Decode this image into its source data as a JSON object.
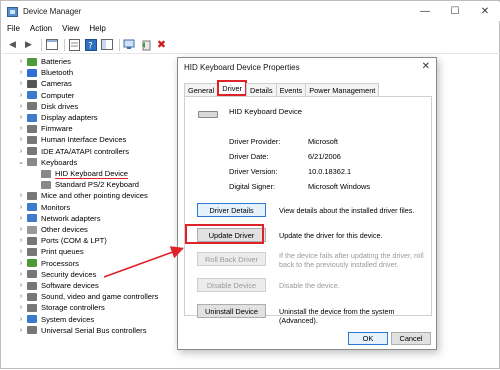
{
  "window": {
    "title": "Device Manager",
    "controls": {
      "minimize": "—",
      "maximize": "☐",
      "close": "✕"
    }
  },
  "menu": [
    "File",
    "Action",
    "View",
    "Help"
  ],
  "tree": [
    {
      "label": "Batteries",
      "expanded": false,
      "color": "#4e9a3a"
    },
    {
      "label": "Bluetooth",
      "expanded": false,
      "color": "#2d6fd6"
    },
    {
      "label": "Cameras",
      "expanded": false,
      "color": "#555555"
    },
    {
      "label": "Computer",
      "expanded": false,
      "color": "#3d7cc9"
    },
    {
      "label": "Disk drives",
      "expanded": false,
      "color": "#777777"
    },
    {
      "label": "Display adapters",
      "expanded": false,
      "color": "#3d7cc9"
    },
    {
      "label": "Firmware",
      "expanded": false,
      "color": "#777777"
    },
    {
      "label": "Human Interface Devices",
      "expanded": false,
      "color": "#777777"
    },
    {
      "label": "IDE ATA/ATAPI controllers",
      "expanded": false,
      "color": "#777777"
    },
    {
      "label": "Keyboards",
      "expanded": true,
      "color": "#888888"
    },
    {
      "label": "HID Keyboard Device",
      "child": true,
      "highlight": true,
      "color": "#888888"
    },
    {
      "label": "Standard PS/2 Keyboard",
      "child": true,
      "color": "#888888"
    },
    {
      "label": "Mice and other pointing devices",
      "expanded": false,
      "color": "#777777"
    },
    {
      "label": "Monitors",
      "expanded": false,
      "color": "#3d7cc9"
    },
    {
      "label": "Network adapters",
      "expanded": false,
      "color": "#3d7cc9"
    },
    {
      "label": "Other devices",
      "expanded": false,
      "color": "#999999"
    },
    {
      "label": "Ports (COM & LPT)",
      "expanded": false,
      "color": "#777777"
    },
    {
      "label": "Print queues",
      "expanded": false,
      "color": "#777777"
    },
    {
      "label": "Processors",
      "expanded": false,
      "color": "#4e9a3a"
    },
    {
      "label": "Security devices",
      "expanded": false,
      "color": "#777777"
    },
    {
      "label": "Software devices",
      "expanded": false,
      "color": "#777777"
    },
    {
      "label": "Sound, video and game controllers",
      "expanded": false,
      "color": "#777777"
    },
    {
      "label": "Storage controllers",
      "expanded": false,
      "color": "#777777"
    },
    {
      "label": "System devices",
      "expanded": false,
      "color": "#3d7cc9"
    },
    {
      "label": "Universal Serial Bus controllers",
      "expanded": false,
      "color": "#777777"
    }
  ],
  "dialog": {
    "title": "HID Keyboard Device Properties",
    "close": "✕",
    "tabs": [
      "General",
      "Driver",
      "Details",
      "Events",
      "Power Management"
    ],
    "active_tab": "Driver",
    "device_name": "HID Keyboard Device",
    "fields": [
      {
        "key": "Driver Provider:",
        "value": "Microsoft"
      },
      {
        "key": "Driver Date:",
        "value": "6/21/2006"
      },
      {
        "key": "Driver Version:",
        "value": "10.0.18362.1"
      },
      {
        "key": "Digital Signer:",
        "value": "Microsoft Windows"
      }
    ],
    "actions": [
      {
        "button": "Driver Details",
        "desc": "View details about the installed driver files.",
        "enabled": true
      },
      {
        "button": "Update Driver",
        "desc": "Update the driver for this device.",
        "enabled": true
      },
      {
        "button": "Roll Back Driver",
        "desc": "If the device fails after updating the driver, roll back to the previously installed driver.",
        "enabled": false
      },
      {
        "button": "Disable Device",
        "desc": "Disable the device.",
        "enabled": false
      },
      {
        "button": "Uninstall Device",
        "desc": "Uninstall the device from the system (Advanced).",
        "enabled": true
      }
    ],
    "ok_label": "OK",
    "cancel_label": "Cancel"
  },
  "annotation_color": "#e0232a"
}
